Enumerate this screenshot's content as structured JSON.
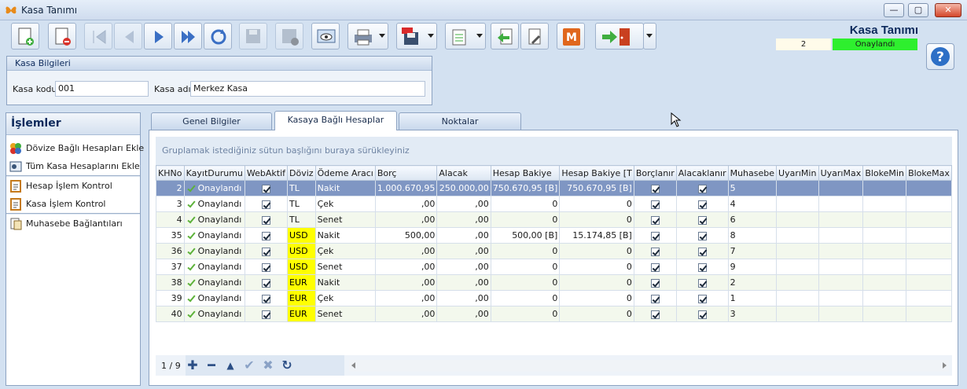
{
  "window": {
    "title": "Kasa Tanımı"
  },
  "header": {
    "form_title": "Kasa Tanımı",
    "record_no": "2",
    "record_status": "Onaylandı"
  },
  "kasa_bilgileri": {
    "title": "Kasa Bilgileri",
    "kasa_kodu_label": "Kasa kodu",
    "kasa_kodu_value": "001",
    "kasa_adi_label": "Kasa adı",
    "kasa_adi_value": "Merkez Kasa"
  },
  "islemler": {
    "title": "İşlemler",
    "items": [
      "Dövize Bağlı Hesapları Ekle",
      "Tüm Kasa Hesaplarını Ekle",
      "Hesap İşlem Kontrol",
      "Kasa İşlem Kontrol",
      "Muhasebe Bağlantıları"
    ]
  },
  "tabs": [
    "Genel Bilgiler",
    "Kasaya Bağlı Hesaplar",
    "Noktalar"
  ],
  "grid": {
    "group_hint": "Gruplamak istediğiniz sütun başlığını buraya sürükleyiniz",
    "columns": [
      "KHNo",
      "KayıtDurumu",
      "WebAktif",
      "Döviz",
      "Ödeme Aracı",
      "Borç",
      "Alacak",
      "Hesap Bakiye",
      "Hesap Bakiye [T",
      "Borçlanır",
      "Alacaklanır",
      "Muhasebe",
      "UyarıMin",
      "UyarıMax",
      "BlokeMin",
      "BlokeMax"
    ],
    "rows": [
      {
        "khno": "2",
        "durum": "Onaylandı",
        "doviz": "TL",
        "odeme": "Nakit",
        "borc": "1.000.670,95",
        "alacak": "250.000,00",
        "bakiye": "750.670,95 [B]",
        "bakiye_t": "750.670,95 [B]",
        "muhasebe": "5"
      },
      {
        "khno": "3",
        "durum": "Onaylandı",
        "doviz": "TL",
        "odeme": "Çek",
        "borc": ",00",
        "alacak": ",00",
        "bakiye": "0",
        "bakiye_t": "0",
        "muhasebe": "4"
      },
      {
        "khno": "4",
        "durum": "Onaylandı",
        "doviz": "TL",
        "odeme": "Senet",
        "borc": ",00",
        "alacak": ",00",
        "bakiye": "0",
        "bakiye_t": "0",
        "muhasebe": "6"
      },
      {
        "khno": "35",
        "durum": "Onaylandı",
        "doviz": "USD",
        "odeme": "Nakit",
        "borc": "500,00",
        "alacak": ",00",
        "bakiye": "500,00 [B]",
        "bakiye_t": "15.174,85 [B]",
        "muhasebe": "8"
      },
      {
        "khno": "36",
        "durum": "Onaylandı",
        "doviz": "USD",
        "odeme": "Çek",
        "borc": ",00",
        "alacak": ",00",
        "bakiye": "0",
        "bakiye_t": "0",
        "muhasebe": "7"
      },
      {
        "khno": "37",
        "durum": "Onaylandı",
        "doviz": "USD",
        "odeme": "Senet",
        "borc": ",00",
        "alacak": ",00",
        "bakiye": "0",
        "bakiye_t": "0",
        "muhasebe": "9"
      },
      {
        "khno": "38",
        "durum": "Onaylandı",
        "doviz": "EUR",
        "odeme": "Nakit",
        "borc": ",00",
        "alacak": ",00",
        "bakiye": "0",
        "bakiye_t": "0",
        "muhasebe": "2"
      },
      {
        "khno": "39",
        "durum": "Onaylandı",
        "doviz": "EUR",
        "odeme": "Çek",
        "borc": ",00",
        "alacak": ",00",
        "bakiye": "0",
        "bakiye_t": "0",
        "muhasebe": "1"
      },
      {
        "khno": "40",
        "durum": "Onaylandı",
        "doviz": "EUR",
        "odeme": "Senet",
        "borc": ",00",
        "alacak": ",00",
        "bakiye": "0",
        "bakiye_t": "0",
        "muhasebe": "3"
      }
    ],
    "pager": "1 / 9"
  },
  "colors": {
    "selected_row": "#7f96c3",
    "currency_highlight": "#ffff00",
    "status_ok": "#2eef2e"
  }
}
